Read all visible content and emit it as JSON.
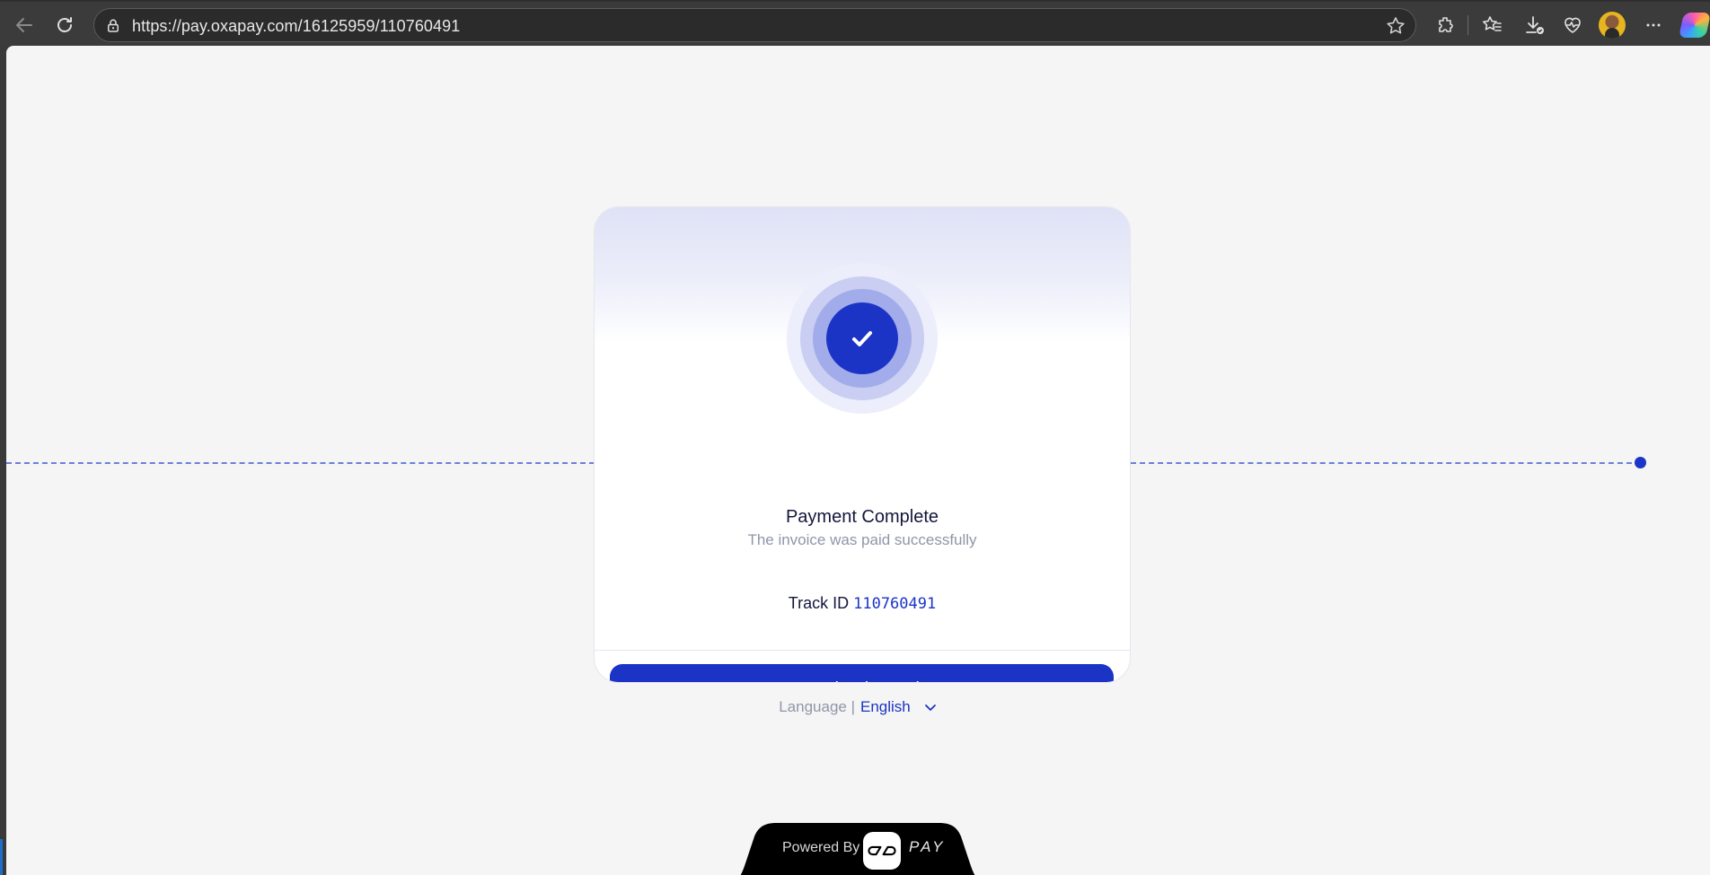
{
  "browser": {
    "url": "https://pay.oxapay.com/16125959/110760491",
    "icons": [
      "back-arrow-icon",
      "refresh-icon",
      "lock-icon",
      "star-icon",
      "extensions-icon",
      "favorites-icon",
      "downloads-icon",
      "health-icon",
      "profile-avatar",
      "more-icon",
      "copilot-icon"
    ]
  },
  "card": {
    "title": "Payment Complete",
    "subtitle": "The invoice was paid successfully",
    "track_label": "Track ID",
    "track_id": "110760491",
    "download_label": "Download Receipt"
  },
  "language": {
    "label": "Language |",
    "value": "English"
  },
  "footer": {
    "powered_by": "Powered By",
    "brand": "PAY"
  },
  "colors": {
    "accent": "#1b34c6",
    "background": "#f5f5f5",
    "dash": "#6d7fd9"
  }
}
